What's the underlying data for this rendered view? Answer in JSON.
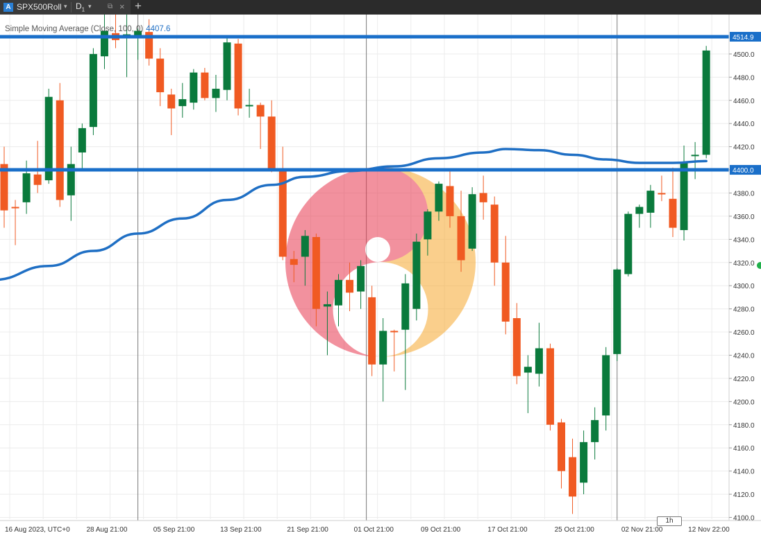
{
  "tab": {
    "app_icon": "A",
    "symbol": "SPX500Roll",
    "timeframe": "D",
    "timeframe_sub": "1",
    "caret": "▾",
    "popout_icon": "⧉",
    "close_icon": "×",
    "add_icon": "+"
  },
  "indicator": {
    "label": "Simple Moving Average (Close, 100, 0)",
    "value": "4407.6"
  },
  "timeframe_badge": "1h",
  "colors": {
    "bull": "#0a7a3c",
    "bear": "#f05a22",
    "sma": "#1f6fc4",
    "hline": "#1a6fc9",
    "grid": "#ececec",
    "vline": "#7a7a7a"
  },
  "chart_data": {
    "type": "candlestick",
    "ylim": [
      4100,
      4527
    ],
    "y_ticks": [
      4100,
      4120,
      4140,
      4160,
      4180,
      4200,
      4220,
      4240,
      4260,
      4280,
      4300,
      4320,
      4340,
      4360,
      4380,
      4400,
      4420,
      4440,
      4460,
      4480,
      4500
    ],
    "y_tick_labels": [
      "4100.0",
      "4120.0",
      "4140.0",
      "4160.0",
      "4180.0",
      "4200.0",
      "4220.0",
      "4240.0",
      "4260.0",
      "4280.0",
      "4300.0",
      "4320.0",
      "4340.0",
      "4360.0",
      "4380.0",
      "4400.0",
      "4420.0",
      "4440.0",
      "4460.0",
      "4480.0",
      "4500.0"
    ],
    "x_labels": [
      {
        "bar": 0,
        "text": "16 Aug 2023, UTC+0"
      },
      {
        "bar": 9.5,
        "text": "28 Aug 21:00"
      },
      {
        "bar": 15.5,
        "text": "05 Sep 21:00"
      },
      {
        "bar": 21.5,
        "text": "13 Sep 21:00"
      },
      {
        "bar": 27.5,
        "text": "21 Sep 21:00"
      },
      {
        "bar": 33.5,
        "text": "01 Oct 21:00"
      },
      {
        "bar": 39.5,
        "text": "09 Oct 21:00"
      },
      {
        "bar": 45.5,
        "text": "17 Oct 21:00"
      },
      {
        "bar": 51.5,
        "text": "25 Oct 21:00"
      },
      {
        "bar": 57.5,
        "text": "02 Nov 21:00"
      },
      {
        "bar": 63.5,
        "text": "12 Nov 22:00"
      }
    ],
    "period_separators": [
      12,
      32.5,
      55
    ],
    "horizontal_lines": [
      {
        "price": 4514.9,
        "label": "4514.9"
      },
      {
        "price": 4400.0,
        "label": "4400.0"
      }
    ],
    "sma_label": "Simple Moving Average (Close, 100, 0)",
    "candles": [
      {
        "o": 4405,
        "h": 4420,
        "l": 4350,
        "c": 4365
      },
      {
        "o": 4368,
        "h": 4374,
        "l": 4335,
        "c": 4367
      },
      {
        "o": 4372,
        "h": 4408,
        "l": 4362,
        "c": 4397
      },
      {
        "o": 4396,
        "h": 4425,
        "l": 4380,
        "c": 4387
      },
      {
        "o": 4391,
        "h": 4470,
        "l": 4388,
        "c": 4463
      },
      {
        "o": 4460,
        "h": 4475,
        "l": 4368,
        "c": 4374
      },
      {
        "o": 4378,
        "h": 4420,
        "l": 4356,
        "c": 4405
      },
      {
        "o": 4415,
        "h": 4440,
        "l": 4400,
        "c": 4436
      },
      {
        "o": 4437,
        "h": 4505,
        "l": 4430,
        "c": 4500
      },
      {
        "o": 4498,
        "h": 4545,
        "l": 4487,
        "c": 4520
      },
      {
        "o": 4518,
        "h": 4545,
        "l": 4505,
        "c": 4512
      },
      {
        "o": 4517,
        "h": 4535,
        "l": 4480,
        "c": 4517
      },
      {
        "o": 4514,
        "h": 4522,
        "l": 4495,
        "c": 4520
      },
      {
        "o": 4519,
        "h": 4530,
        "l": 4490,
        "c": 4496
      },
      {
        "o": 4496,
        "h": 4505,
        "l": 4455,
        "c": 4467
      },
      {
        "o": 4465,
        "h": 4470,
        "l": 4430,
        "c": 4453
      },
      {
        "o": 4455,
        "h": 4475,
        "l": 4445,
        "c": 4461
      },
      {
        "o": 4458,
        "h": 4487,
        "l": 4452,
        "c": 4484
      },
      {
        "o": 4484,
        "h": 4488,
        "l": 4460,
        "c": 4462
      },
      {
        "o": 4462,
        "h": 4482,
        "l": 4450,
        "c": 4470
      },
      {
        "o": 4469,
        "h": 4515,
        "l": 4460,
        "c": 4510
      },
      {
        "o": 4509,
        "h": 4513,
        "l": 4447,
        "c": 4453
      },
      {
        "o": 4455,
        "h": 4470,
        "l": 4445,
        "c": 4456
      },
      {
        "o": 4456,
        "h": 4458,
        "l": 4418,
        "c": 4446
      },
      {
        "o": 4446,
        "h": 4460,
        "l": 4398,
        "c": 4400
      },
      {
        "o": 4400,
        "h": 4420,
        "l": 4322,
        "c": 4325
      },
      {
        "o": 4323,
        "h": 4330,
        "l": 4303,
        "c": 4318
      },
      {
        "o": 4325,
        "h": 4348,
        "l": 4300,
        "c": 4343
      },
      {
        "o": 4342,
        "h": 4345,
        "l": 4265,
        "c": 4280
      },
      {
        "o": 4282,
        "h": 4295,
        "l": 4240,
        "c": 4284
      },
      {
        "o": 4283,
        "h": 4310,
        "l": 4265,
        "c": 4305
      },
      {
        "o": 4305,
        "h": 4320,
        "l": 4278,
        "c": 4294
      },
      {
        "o": 4295,
        "h": 4322,
        "l": 4280,
        "c": 4317
      },
      {
        "o": 4290,
        "h": 4300,
        "l": 4222,
        "c": 4232
      },
      {
        "o": 4232,
        "h": 4272,
        "l": 4200,
        "c": 4261
      },
      {
        "o": 4261,
        "h": 4262,
        "l": 4226,
        "c": 4260
      },
      {
        "o": 4262,
        "h": 4310,
        "l": 4210,
        "c": 4302
      },
      {
        "o": 4280,
        "h": 4345,
        "l": 4270,
        "c": 4338
      },
      {
        "o": 4340,
        "h": 4366,
        "l": 4326,
        "c": 4364
      },
      {
        "o": 4364,
        "h": 4390,
        "l": 4356,
        "c": 4388
      },
      {
        "o": 4386,
        "h": 4400,
        "l": 4350,
        "c": 4360
      },
      {
        "o": 4360,
        "h": 4382,
        "l": 4312,
        "c": 4322
      },
      {
        "o": 4332,
        "h": 4385,
        "l": 4330,
        "c": 4379
      },
      {
        "o": 4380,
        "h": 4395,
        "l": 4357,
        "c": 4372
      },
      {
        "o": 4370,
        "h": 4377,
        "l": 4300,
        "c": 4320
      },
      {
        "o": 4320,
        "h": 4343,
        "l": 4258,
        "c": 4269
      },
      {
        "o": 4272,
        "h": 4285,
        "l": 4215,
        "c": 4222
      },
      {
        "o": 4225,
        "h": 4240,
        "l": 4190,
        "c": 4230
      },
      {
        "o": 4224,
        "h": 4268,
        "l": 4213,
        "c": 4246
      },
      {
        "o": 4246,
        "h": 4250,
        "l": 4175,
        "c": 4180
      },
      {
        "o": 4182,
        "h": 4185,
        "l": 4125,
        "c": 4140
      },
      {
        "o": 4152,
        "h": 4168,
        "l": 4103,
        "c": 4118
      },
      {
        "o": 4130,
        "h": 4175,
        "l": 4120,
        "c": 4165
      },
      {
        "o": 4165,
        "h": 4195,
        "l": 4150,
        "c": 4184
      },
      {
        "o": 4188,
        "h": 4247,
        "l": 4175,
        "c": 4240
      },
      {
        "o": 4241,
        "h": 4315,
        "l": 4235,
        "c": 4314
      },
      {
        "o": 4310,
        "h": 4364,
        "l": 4308,
        "c": 4362
      },
      {
        "o": 4362,
        "h": 4370,
        "l": 4350,
        "c": 4368
      },
      {
        "o": 4363,
        "h": 4387,
        "l": 4350,
        "c": 4382
      },
      {
        "o": 4380,
        "h": 4395,
        "l": 4373,
        "c": 4379
      },
      {
        "o": 4375,
        "h": 4402,
        "l": 4342,
        "c": 4350
      },
      {
        "o": 4348,
        "h": 4421,
        "l": 4339,
        "c": 4406
      },
      {
        "o": 4412,
        "h": 4424,
        "l": 4392,
        "c": 4413
      },
      {
        "o": 4413,
        "h": 4507,
        "l": 4410,
        "c": 4503
      }
    ],
    "sma_points": [
      {
        "bar": -1,
        "v": 4305
      },
      {
        "bar": 4,
        "v": 4317
      },
      {
        "bar": 8,
        "v": 4330
      },
      {
        "bar": 12,
        "v": 4345
      },
      {
        "bar": 16,
        "v": 4358
      },
      {
        "bar": 20,
        "v": 4374
      },
      {
        "bar": 24,
        "v": 4387
      },
      {
        "bar": 27,
        "v": 4394
      },
      {
        "bar": 31,
        "v": 4399
      },
      {
        "bar": 35,
        "v": 4403
      },
      {
        "bar": 39,
        "v": 4410
      },
      {
        "bar": 43,
        "v": 4415
      },
      {
        "bar": 45,
        "v": 4418
      },
      {
        "bar": 48,
        "v": 4417
      },
      {
        "bar": 51,
        "v": 4413
      },
      {
        "bar": 54,
        "v": 4409
      },
      {
        "bar": 57,
        "v": 4406
      },
      {
        "bar": 60,
        "v": 4406
      },
      {
        "bar": 63,
        "v": 4407.6
      }
    ]
  }
}
